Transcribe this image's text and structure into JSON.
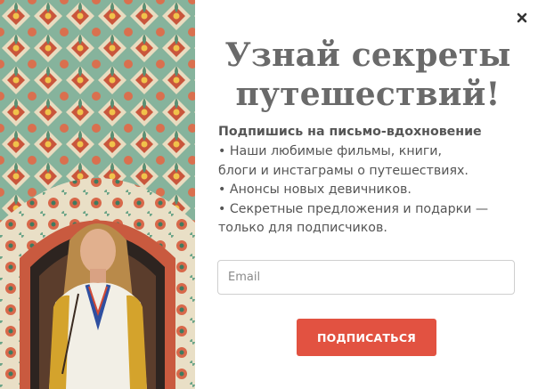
{
  "popup": {
    "title_line1": "Узнай секреты",
    "title_line2": "путешествий!",
    "lead": "Подпишись на письмо-вдохновение",
    "bullets": [
      "• Наши любимые фильмы, книги,",
      "блоги и инстаграмы о путешествиях.",
      "• Анонсы новых девичников.",
      "• Секретные предложения и подарки —",
      "только для подписчиков."
    ],
    "email_placeholder": "Email",
    "email_value": "",
    "submit_label": "ПОДПИСАТЬСЯ",
    "close_icon": "close-icon",
    "photo_icon": "travel-photo-woman-in-ornate-archway"
  },
  "colors": {
    "title": "#6a6a6a",
    "text": "#555555",
    "button": "#e25241",
    "button_text": "#ffffff",
    "input_border": "#cfcfcf"
  }
}
